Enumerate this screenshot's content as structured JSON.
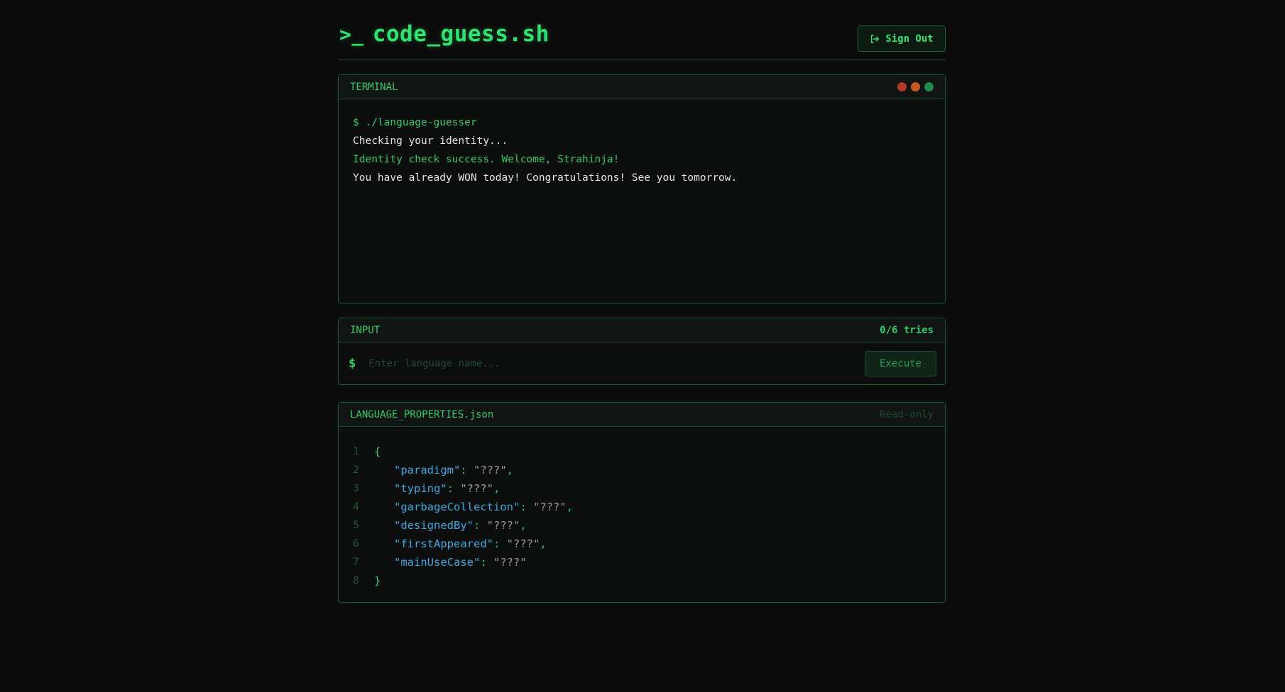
{
  "header": {
    "logo_icon": ">_",
    "title": "code_guess.sh",
    "signout_label": "Sign Out"
  },
  "terminal": {
    "title": "TERMINAL",
    "dot_colors": [
      "#b23a26",
      "#c45a24",
      "#1e8a4a"
    ],
    "lines": [
      "$ ./language-guesser",
      "Checking your identity...",
      "Identity check success. Welcome, Strahinja!",
      "You have already WON today! Congratulations! See you tomorrow."
    ]
  },
  "input": {
    "title": "INPUT",
    "tries": "0/6 tries",
    "prompt": "$",
    "placeholder": "Enter language name...",
    "value": "",
    "execute_label": "Execute"
  },
  "json_panel": {
    "title": "LANGUAGE_PROPERTIES.json",
    "badge": "Read-only",
    "line_numbers": [
      "1",
      "2",
      "3",
      "4",
      "5",
      "6",
      "7",
      "8"
    ],
    "open_brace": "{",
    "close_brace": "}",
    "properties": [
      {
        "key": "\"paradigm\"",
        "value": "\"???\"",
        "comma": ","
      },
      {
        "key": "\"typing\"",
        "value": "\"???\"",
        "comma": ","
      },
      {
        "key": "\"garbageCollection\"",
        "value": "\"???\"",
        "comma": ","
      },
      {
        "key": "\"designedBy\"",
        "value": "\"???\"",
        "comma": ","
      },
      {
        "key": "\"firstAppeared\"",
        "value": "\"???\"",
        "comma": ","
      },
      {
        "key": "\"mainUseCase\"",
        "value": "\"???\"",
        "comma": ""
      }
    ]
  },
  "colors": {
    "accent": "#2ee36f",
    "key": "#39a9e0",
    "background": "#0b0b0b"
  }
}
